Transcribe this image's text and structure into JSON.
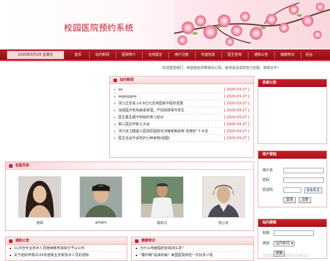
{
  "header": {
    "title": "校园医院预约系统"
  },
  "nav": {
    "date": "2020年3月1日 星期五",
    "items": [
      "首页",
      "站内新闻",
      "医院简介",
      "在线留言",
      "用户注册",
      "科室信息",
      "医生查询",
      "通知公告",
      "健康常识",
      "后台"
    ]
  },
  "marquee": "欢迎登陆我们，希望能给您带来好心情，其他说话请您自己挖掘，谢谢合作！",
  "news": {
    "title": "站内新闻",
    "items": [
      {
        "text": "ee",
        "date": "[ 2020-03-27 ]"
      },
      {
        "text": "eegeggew",
        "date": "[ 2020-03-27 ]"
      },
      {
        "text": "浙江五年投入6.6亿元支持国家中医药发展",
        "date": "[ 2020-03-27 ]"
      },
      {
        "text": "加强医疗机构病毒管理，严控院感事件发生",
        "date": "[ 2020-03-27 ]"
      },
      {
        "text": "医生集生都不知晓的育儿知识",
        "date": "[ 2020-03-27 ]"
      },
      {
        "text": "致三医召开职工大会",
        "date": "[ 2020-03-27 ]"
      },
      {
        "text": "浙江省卫健委三医院原副院长涉嫌受贿受审 曾被封“十大名",
        "date": "[ 2020-03-27 ]"
      },
      {
        "text": "医生永远不会吃的七种食物(组图)",
        "date": "[ 2020-03-27 ]"
      }
    ]
  },
  "doctors": {
    "title": "名医风采",
    "items": [
      {
        "name": "李四"
      },
      {
        "name": "gregre"
      },
      {
        "name": "陈利江"
      },
      {
        "name": "张小冬"
      }
    ]
  },
  "notice_panel": {
    "title": "通知公告",
    "items": [
      "11月份专业技术人员继续教育成绩元予以公布",
      "关于组织申报2020年度新业务新技术人员的通知"
    ]
  },
  "health_panel": {
    "title": "健康常识",
    "items": [
      "为什么电脑辐射容易掉头发？",
      "\"藏中精\"是谁的病？美国医院体检一次好多少钱"
    ]
  },
  "sidebar": {
    "notice_title": "系统公告",
    "login": {
      "title": "用户登陆",
      "username_label": "用户名",
      "password_label": "密码",
      "captcha_label": "验证码",
      "captcha_value": "9603",
      "login_button": "登录",
      "register_button": "注册"
    },
    "search": {
      "title": "站内搜索",
      "keyword_label": "标题",
      "category_label": "类别",
      "category_value": "站内新闻",
      "search_button": "搜索"
    }
  },
  "watermark": "https://jq2892034822"
}
